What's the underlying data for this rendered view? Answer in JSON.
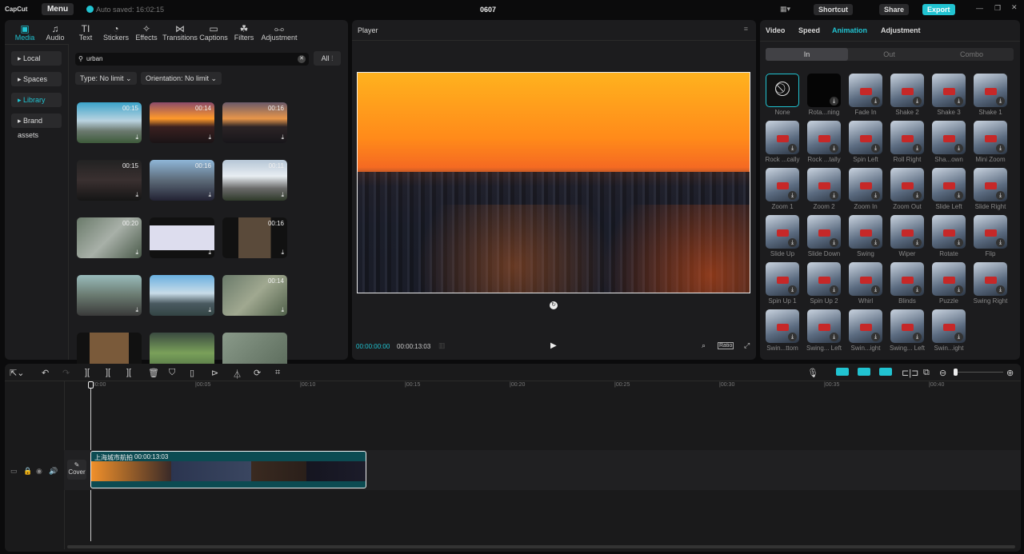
{
  "app": {
    "logo": "CapCut",
    "menu": "Menu",
    "autosave": "Auto saved: 16:02:15",
    "title": "0607",
    "shortcut": "Shortcut",
    "share": "Share",
    "export": "Export",
    "accent": "#21c3d1"
  },
  "media_tabs": [
    {
      "label": "Media",
      "icon": "media-icon"
    },
    {
      "label": "Audio",
      "icon": "audio-icon"
    },
    {
      "label": "Text",
      "icon": "text-icon"
    },
    {
      "label": "Stickers",
      "icon": "sticker-icon"
    },
    {
      "label": "Effects",
      "icon": "effects-icon"
    },
    {
      "label": "Transitions",
      "icon": "transitions-icon"
    },
    {
      "label": "Captions",
      "icon": "captions-icon"
    },
    {
      "label": "Filters",
      "icon": "filters-icon"
    },
    {
      "label": "Adjustment",
      "icon": "adjustment-icon"
    }
  ],
  "sidebar": [
    "Local",
    "Spaces",
    "Library",
    "Brand assets"
  ],
  "search": {
    "value": "urban",
    "filter_all": "All",
    "type_filter": "Type: No limit",
    "orientation_filter": "Orientation: No limit"
  },
  "library": [
    {
      "duration": "00:15"
    },
    {
      "duration": "00:14"
    },
    {
      "duration": "00:16"
    },
    {
      "duration": "00:15"
    },
    {
      "duration": "00:16"
    },
    {
      "duration": "00:11"
    },
    {
      "duration": "00:20"
    },
    {
      "duration": ""
    },
    {
      "duration": "00:16"
    },
    {
      "duration": ""
    },
    {
      "duration": ""
    },
    {
      "duration": "00:14"
    },
    {
      "duration": ""
    },
    {
      "duration": ""
    },
    {
      "duration": ""
    }
  ],
  "player": {
    "title": "Player",
    "current": "00:00:00:00",
    "total": "00:00:13:03",
    "ratio": "Ratio"
  },
  "right": {
    "tabs": [
      "Video",
      "Speed",
      "Animation",
      "Adjustment"
    ],
    "subtabs": [
      "In",
      "Out",
      "Combo"
    ],
    "animations": [
      "None",
      "Rota...ning",
      "Fade In",
      "Shake 2",
      "Shake 3",
      "Shake 1",
      "Rock ...cally",
      "Rock ...tally",
      "Spin Left",
      "Roll Right",
      "Sha...own",
      "Mini Zoom",
      "Zoom 1",
      "Zoom 2",
      "Zoom In",
      "Zoom Out",
      "Slide Left",
      "Slide Right",
      "Slide Up",
      "Slide Down",
      "Swing",
      "Wiper",
      "Rotate",
      "Flip",
      "Spin Up 1",
      "Spin Up 2",
      "Whirl",
      "Blinds",
      "Puzzle",
      "Swing Right",
      "Swin...ttom",
      "Swing... Left",
      "Swin...ight",
      "Swing... Left",
      "Swin...ight"
    ]
  },
  "timeline": {
    "ruler": [
      "00:00",
      "00:05",
      "00:10",
      "00:15",
      "00:20",
      "00:25",
      "00:30",
      "00:35",
      "00:40"
    ],
    "cover": "Cover",
    "clip_name": "上海城市航拍",
    "clip_duration": "00:00:13:03"
  }
}
